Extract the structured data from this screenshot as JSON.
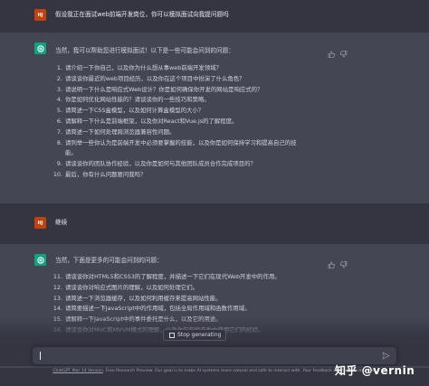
{
  "conversation": {
    "user_avatar": "HJ",
    "msg1": "假设我正在面试web前端开发岗位，你可以模拟面试向我提问题吗",
    "answer1_intro": "当然，我可以帮助您进行模拟面试！以下是一些可能会问到的问题：",
    "answer1_items": [
      {
        "n": "1.",
        "text": "请介绍一下你自己，以及你为什么想从事web前端开发领域？"
      },
      {
        "n": "2.",
        "text": "请谈谈你最近的web项目经历，以及你在这个项目中扮演了什么角色？"
      },
      {
        "n": "3.",
        "text": "请说明一下什么是响应式Web设计？你是如何确保你开发的网站是响应式的？"
      },
      {
        "n": "4.",
        "text": "你是如何优化网站性能的？请谈谈你的一些技巧和策略。"
      },
      {
        "n": "5.",
        "text": "请简述一下CSS盒模型，以及如何计算盒模型的大小？"
      },
      {
        "n": "6.",
        "text": "请解释一下什么是前端框架，以及你对React和Vue.js的了解程度。"
      },
      {
        "n": "7.",
        "text": "请简述一下如何处理跨浏览器兼容性问题。"
      },
      {
        "n": "8.",
        "text": "请列举一些你认为是前端开发中必须要掌握的技能，以及你是如何保持学习和提高自己的技"
      },
      {
        "n": "",
        "text": "能。"
      },
      {
        "n": "9.",
        "text": "请谈谈你的团队协作经验，以及你是如何与其他团队成员合作完成项目的？"
      },
      {
        "n": "10.",
        "text": "最后，你有什么问题要问我吗？"
      }
    ],
    "msg2": "继续",
    "answer2_intro": "当然，下面是更多的可能会问到的问题：",
    "answer2_items": [
      {
        "n": "11.",
        "text": "请谈谈你对HTML5和CSS3的了解程度，并描述一下它们在现代Web开发中的作用。"
      },
      {
        "n": "12.",
        "text": "请谈谈你对响应式图片的理解，以及如何处理它们。"
      },
      {
        "n": "13.",
        "text": "请简述一下浏览器缓存，以及如何利用缓存来提高网站性能。"
      },
      {
        "n": "14.",
        "text": "请简要描述一下JavaScript中的作用域，包括全局作用域和函数作用域。"
      },
      {
        "n": "15.",
        "text": "请解释一下JavaScript中的事件委托是什么，以及它的用途。"
      },
      {
        "n": "16.",
        "text": "请谈谈你对MVC和MVVM模式的理解，以及你在实际开发中使用它们的经验。"
      }
    ]
  },
  "controls": {
    "stop_label": "Stop generating",
    "footer_link": "ChatGPT Mar 14 Version",
    "footer_text": ". Free Research Preview. Our goal is to make AI systems more natural and safe to interact with. Your feedback will help us improve."
  },
  "watermark": "知乎 @vernin",
  "colors": {
    "user_avatar": "#c2410c",
    "bot_avatar": "#10a37f",
    "bot_bg": "#444654",
    "user_bg": "#343541"
  }
}
